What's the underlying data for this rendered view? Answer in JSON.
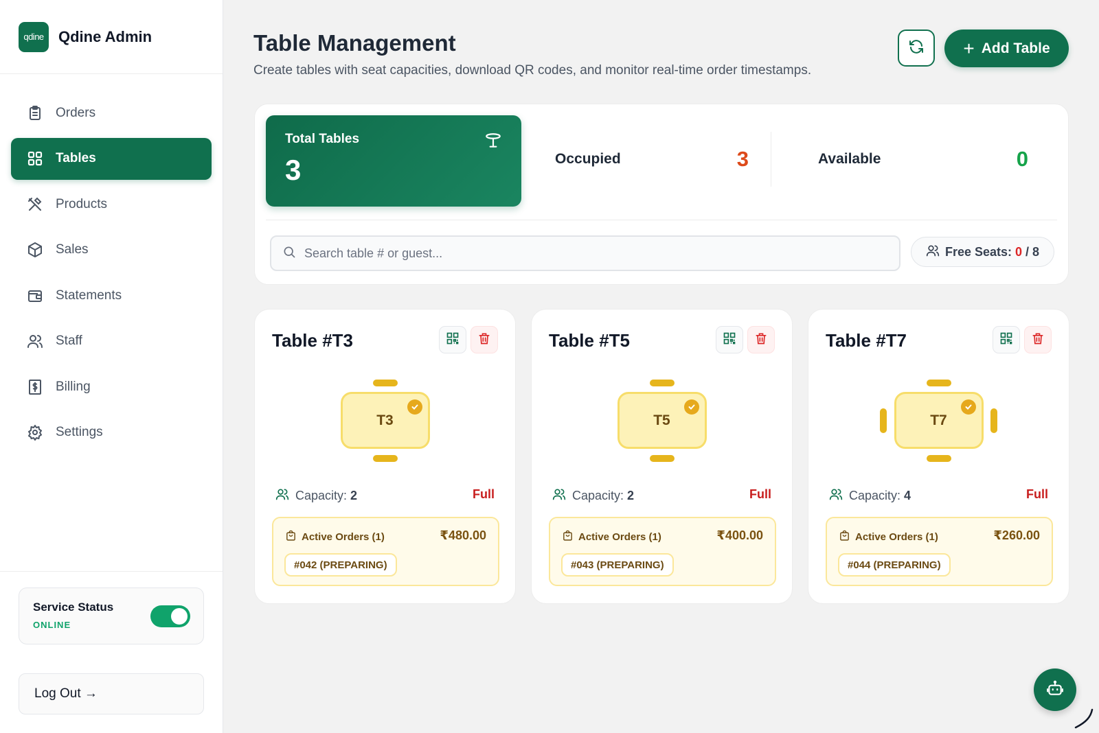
{
  "brand": {
    "logo_text": "qdine",
    "name": "Qdine Admin"
  },
  "sidebar": {
    "items": [
      {
        "label": "Orders",
        "icon": "clipboard-icon",
        "active": false
      },
      {
        "label": "Tables",
        "icon": "grid-icon",
        "active": true
      },
      {
        "label": "Products",
        "icon": "utensils-icon",
        "active": false
      },
      {
        "label": "Sales",
        "icon": "box-icon",
        "active": false
      },
      {
        "label": "Statements",
        "icon": "wallet-icon",
        "active": false
      },
      {
        "label": "Staff",
        "icon": "users-icon",
        "active": false
      },
      {
        "label": "Billing",
        "icon": "receipt-icon",
        "active": false
      },
      {
        "label": "Settings",
        "icon": "gear-icon",
        "active": false
      }
    ],
    "service": {
      "title": "Service Status",
      "state": "ONLINE",
      "enabled": true
    },
    "logout_label": "Log Out →"
  },
  "header": {
    "title": "Table Management",
    "subtitle": "Create tables with seat capacities, download QR codes, and monitor real-time order timestamps.",
    "add_label": "Add Table"
  },
  "stats": {
    "total_label": "Total Tables",
    "total_value": "3",
    "occupied_label": "Occupied",
    "occupied_value": "3",
    "available_label": "Available",
    "available_value": "0"
  },
  "search": {
    "placeholder": "Search table # or guest..."
  },
  "free_seats": {
    "label": "Free Seats:",
    "free": "0",
    "total": "/ 8"
  },
  "colors": {
    "brand": "#10704e",
    "occupied": "#dd4a1a",
    "available": "#16a34a",
    "full": "#c81e1e",
    "seat": "#e6b51c"
  },
  "tables": [
    {
      "title": "Table #T3",
      "code": "T3",
      "capacity_label": "Capacity:",
      "capacity": "2",
      "status": "Full",
      "orders_label": "Active Orders (1)",
      "orders_amount": "₹480.00",
      "order_chip": "#042 (PREPARING)"
    },
    {
      "title": "Table #T5",
      "code": "T5",
      "capacity_label": "Capacity:",
      "capacity": "2",
      "status": "Full",
      "orders_label": "Active Orders (1)",
      "orders_amount": "₹400.00",
      "order_chip": "#043 (PREPARING)"
    },
    {
      "title": "Table #T7",
      "code": "T7",
      "capacity_label": "Capacity:",
      "capacity": "4",
      "status": "Full",
      "orders_label": "Active Orders (1)",
      "orders_amount": "₹260.00",
      "order_chip": "#044 (PREPARING)"
    }
  ]
}
